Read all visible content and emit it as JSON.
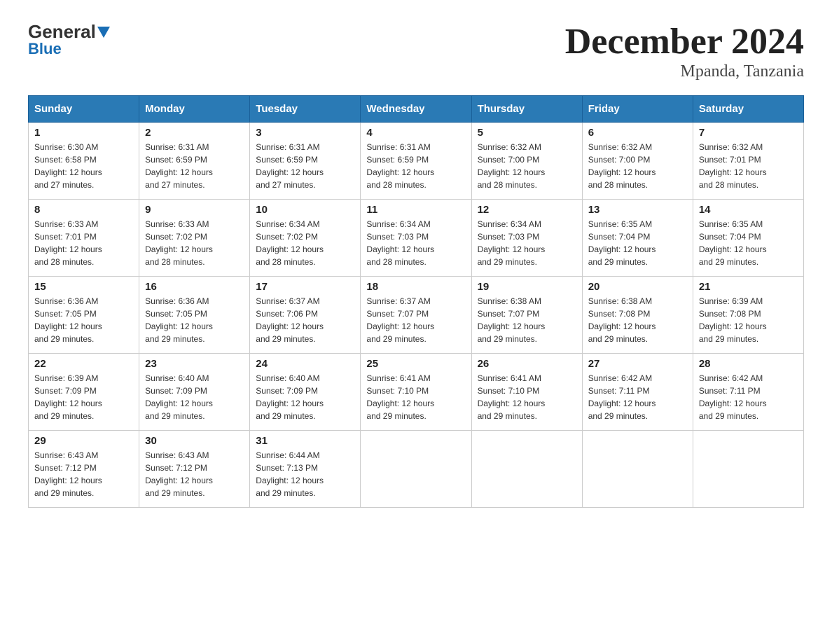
{
  "header": {
    "logo_general": "General",
    "logo_blue": "Blue",
    "title": "December 2024",
    "subtitle": "Mpanda, Tanzania"
  },
  "days_of_week": [
    "Sunday",
    "Monday",
    "Tuesday",
    "Wednesday",
    "Thursday",
    "Friday",
    "Saturday"
  ],
  "weeks": [
    [
      {
        "day": "1",
        "sunrise": "6:30 AM",
        "sunset": "6:58 PM",
        "daylight": "12 hours and 27 minutes."
      },
      {
        "day": "2",
        "sunrise": "6:31 AM",
        "sunset": "6:59 PM",
        "daylight": "12 hours and 27 minutes."
      },
      {
        "day": "3",
        "sunrise": "6:31 AM",
        "sunset": "6:59 PM",
        "daylight": "12 hours and 27 minutes."
      },
      {
        "day": "4",
        "sunrise": "6:31 AM",
        "sunset": "6:59 PM",
        "daylight": "12 hours and 28 minutes."
      },
      {
        "day": "5",
        "sunrise": "6:32 AM",
        "sunset": "7:00 PM",
        "daylight": "12 hours and 28 minutes."
      },
      {
        "day": "6",
        "sunrise": "6:32 AM",
        "sunset": "7:00 PM",
        "daylight": "12 hours and 28 minutes."
      },
      {
        "day": "7",
        "sunrise": "6:32 AM",
        "sunset": "7:01 PM",
        "daylight": "12 hours and 28 minutes."
      }
    ],
    [
      {
        "day": "8",
        "sunrise": "6:33 AM",
        "sunset": "7:01 PM",
        "daylight": "12 hours and 28 minutes."
      },
      {
        "day": "9",
        "sunrise": "6:33 AM",
        "sunset": "7:02 PM",
        "daylight": "12 hours and 28 minutes."
      },
      {
        "day": "10",
        "sunrise": "6:34 AM",
        "sunset": "7:02 PM",
        "daylight": "12 hours and 28 minutes."
      },
      {
        "day": "11",
        "sunrise": "6:34 AM",
        "sunset": "7:03 PM",
        "daylight": "12 hours and 28 minutes."
      },
      {
        "day": "12",
        "sunrise": "6:34 AM",
        "sunset": "7:03 PM",
        "daylight": "12 hours and 29 minutes."
      },
      {
        "day": "13",
        "sunrise": "6:35 AM",
        "sunset": "7:04 PM",
        "daylight": "12 hours and 29 minutes."
      },
      {
        "day": "14",
        "sunrise": "6:35 AM",
        "sunset": "7:04 PM",
        "daylight": "12 hours and 29 minutes."
      }
    ],
    [
      {
        "day": "15",
        "sunrise": "6:36 AM",
        "sunset": "7:05 PM",
        "daylight": "12 hours and 29 minutes."
      },
      {
        "day": "16",
        "sunrise": "6:36 AM",
        "sunset": "7:05 PM",
        "daylight": "12 hours and 29 minutes."
      },
      {
        "day": "17",
        "sunrise": "6:37 AM",
        "sunset": "7:06 PM",
        "daylight": "12 hours and 29 minutes."
      },
      {
        "day": "18",
        "sunrise": "6:37 AM",
        "sunset": "7:07 PM",
        "daylight": "12 hours and 29 minutes."
      },
      {
        "day": "19",
        "sunrise": "6:38 AM",
        "sunset": "7:07 PM",
        "daylight": "12 hours and 29 minutes."
      },
      {
        "day": "20",
        "sunrise": "6:38 AM",
        "sunset": "7:08 PM",
        "daylight": "12 hours and 29 minutes."
      },
      {
        "day": "21",
        "sunrise": "6:39 AM",
        "sunset": "7:08 PM",
        "daylight": "12 hours and 29 minutes."
      }
    ],
    [
      {
        "day": "22",
        "sunrise": "6:39 AM",
        "sunset": "7:09 PM",
        "daylight": "12 hours and 29 minutes."
      },
      {
        "day": "23",
        "sunrise": "6:40 AM",
        "sunset": "7:09 PM",
        "daylight": "12 hours and 29 minutes."
      },
      {
        "day": "24",
        "sunrise": "6:40 AM",
        "sunset": "7:09 PM",
        "daylight": "12 hours and 29 minutes."
      },
      {
        "day": "25",
        "sunrise": "6:41 AM",
        "sunset": "7:10 PM",
        "daylight": "12 hours and 29 minutes."
      },
      {
        "day": "26",
        "sunrise": "6:41 AM",
        "sunset": "7:10 PM",
        "daylight": "12 hours and 29 minutes."
      },
      {
        "day": "27",
        "sunrise": "6:42 AM",
        "sunset": "7:11 PM",
        "daylight": "12 hours and 29 minutes."
      },
      {
        "day": "28",
        "sunrise": "6:42 AM",
        "sunset": "7:11 PM",
        "daylight": "12 hours and 29 minutes."
      }
    ],
    [
      {
        "day": "29",
        "sunrise": "6:43 AM",
        "sunset": "7:12 PM",
        "daylight": "12 hours and 29 minutes."
      },
      {
        "day": "30",
        "sunrise": "6:43 AM",
        "sunset": "7:12 PM",
        "daylight": "12 hours and 29 minutes."
      },
      {
        "day": "31",
        "sunrise": "6:44 AM",
        "sunset": "7:13 PM",
        "daylight": "12 hours and 29 minutes."
      },
      null,
      null,
      null,
      null
    ]
  ],
  "labels": {
    "sunrise": "Sunrise: ",
    "sunset": "Sunset: ",
    "daylight": "Daylight: "
  }
}
